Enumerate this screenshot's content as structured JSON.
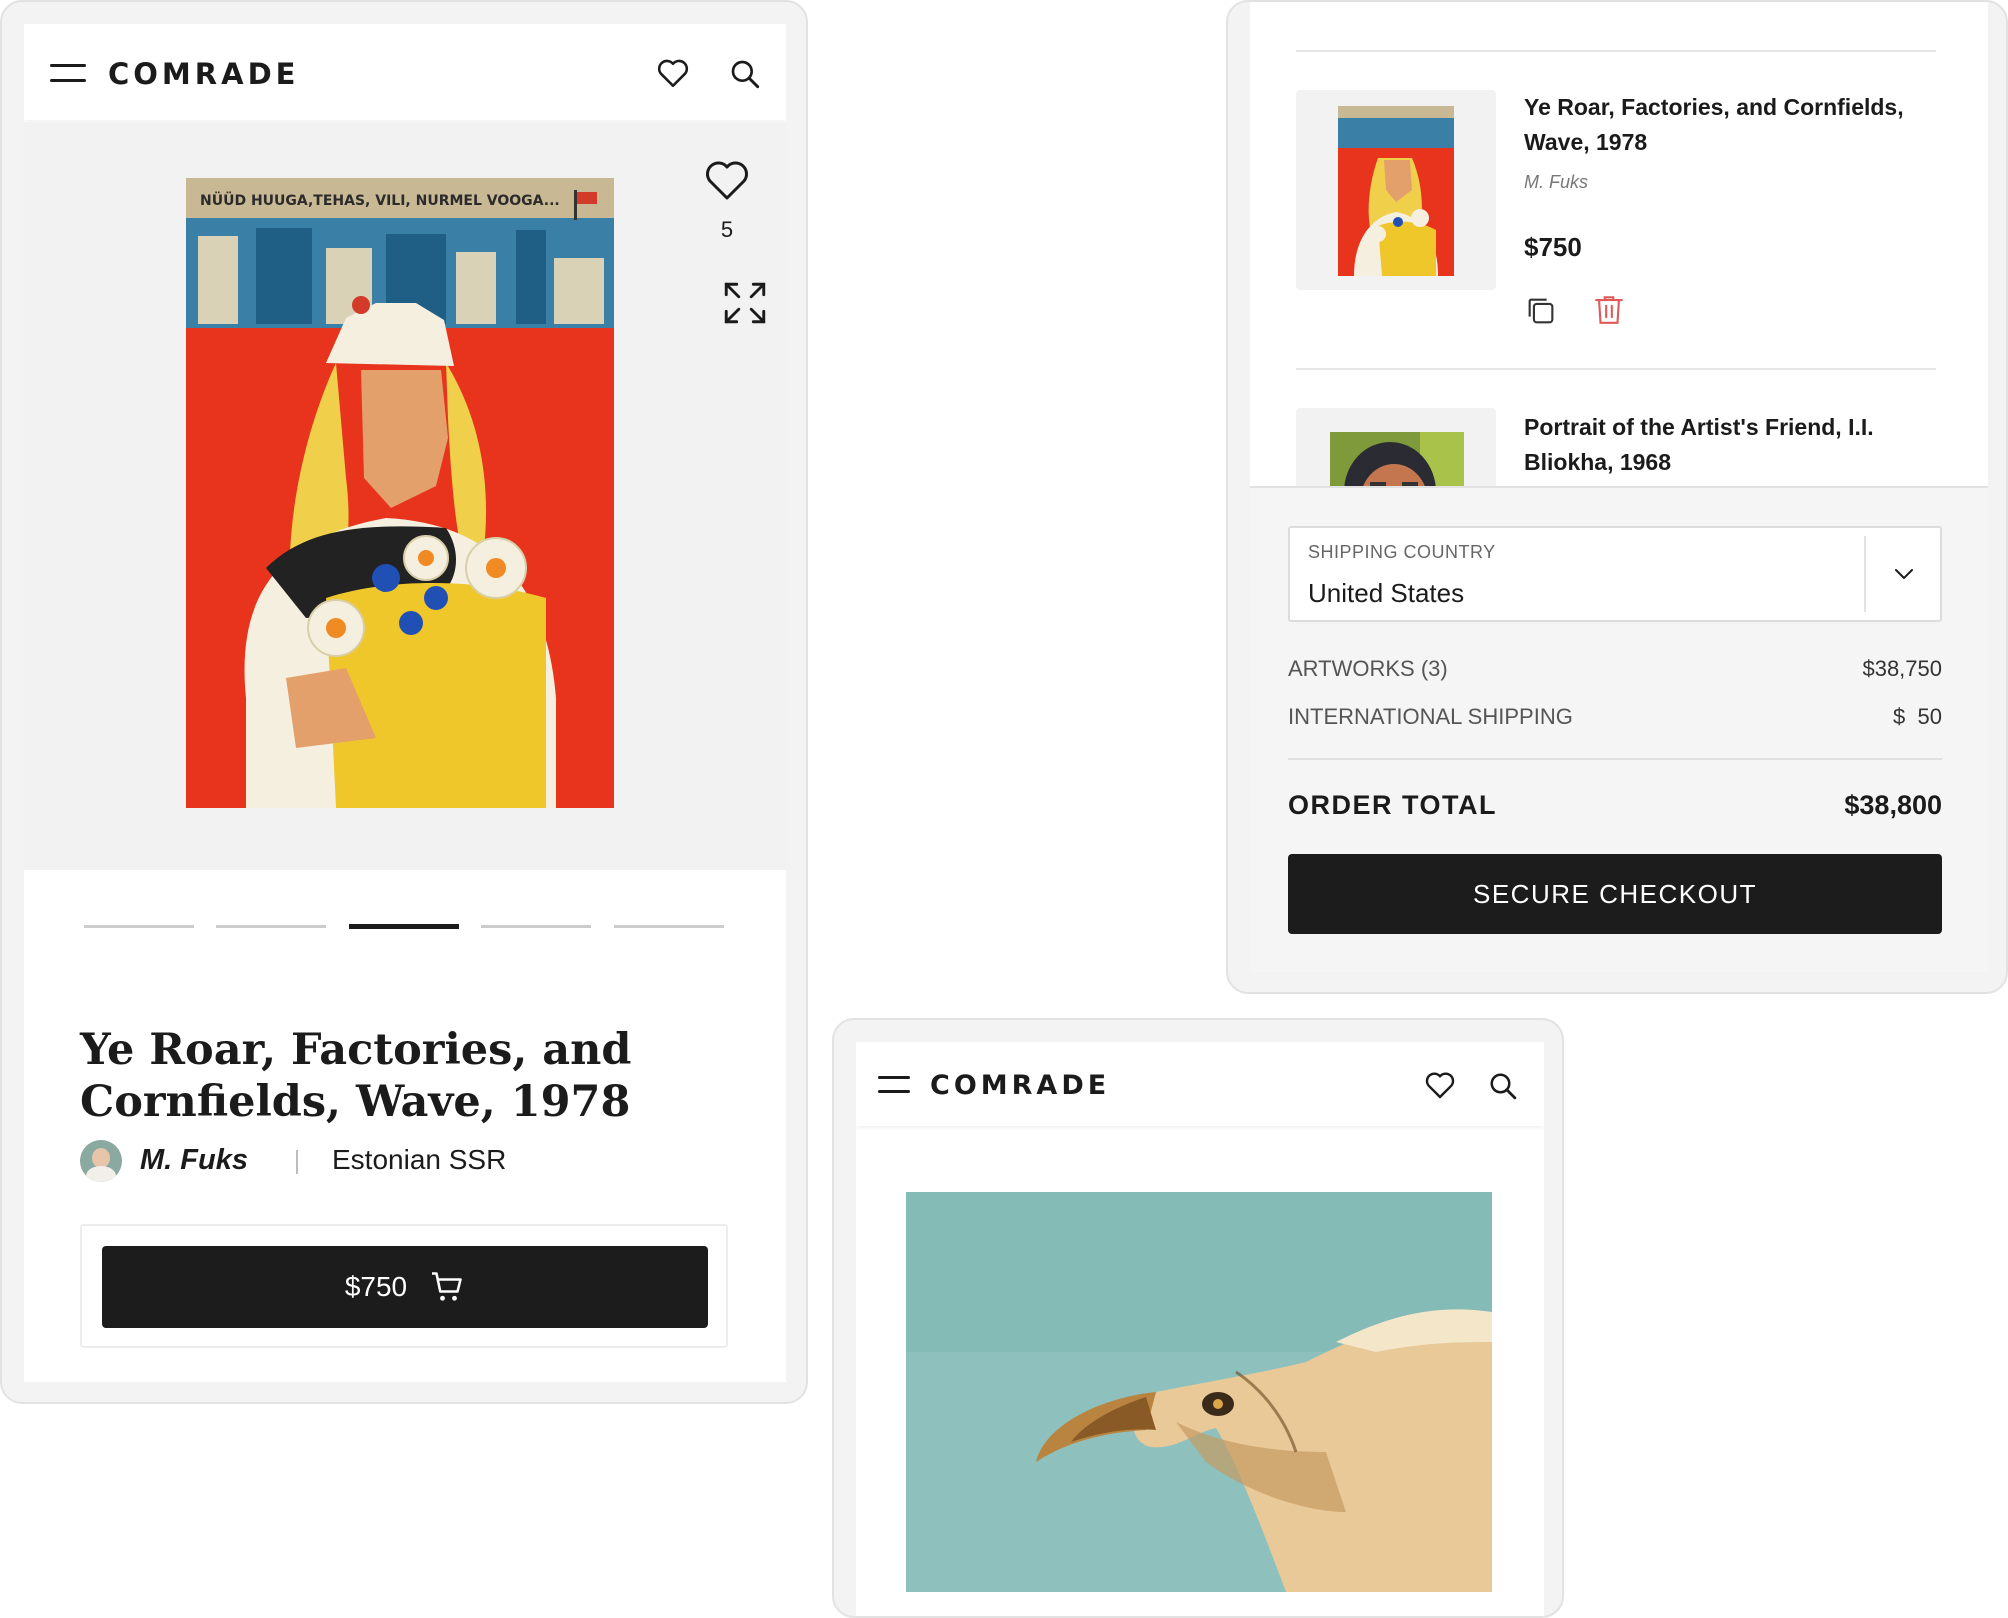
{
  "brand": {
    "logo": "COMRADE"
  },
  "product_screen": {
    "poster_caption": "NÜÜD HUUGA,TEHAS, VILI, NURMEL VOOGA...",
    "like_count": "5",
    "carousel_total": 5,
    "carousel_active": 3,
    "title": "Ye Roar, Factories, and Cornfields, Wave, 1978",
    "artist": "M. Fuks",
    "origin": "Estonian SSR",
    "price_button": "$750",
    "icons": [
      "menu-icon",
      "heart-icon",
      "search-icon",
      "expand-icon",
      "cart-icon"
    ]
  },
  "cart_screen": {
    "items": [
      {
        "title": "Ye Roar, Factories, and Cornfields, Wave, 1978",
        "artist": "M. Fuks",
        "price": "$750"
      },
      {
        "title": "Portrait of the Artist's Friend, I.I. Bliokha, 1968"
      }
    ],
    "shipping": {
      "label": "SHIPPING COUNTRY",
      "value": "United States"
    },
    "summary": {
      "artworks_label": "ARTWORKS (3)",
      "artworks_value": "$38,750",
      "shipping_label": "INTERNATIONAL SHIPPING",
      "shipping_currency": "$",
      "shipping_value": "50",
      "total_label": "ORDER TOTAL",
      "total_value": "$38,800"
    },
    "checkout_button": "SECURE CHECKOUT",
    "colors": {
      "delete": "#e05a5a",
      "button": "#1c1c1c"
    }
  }
}
